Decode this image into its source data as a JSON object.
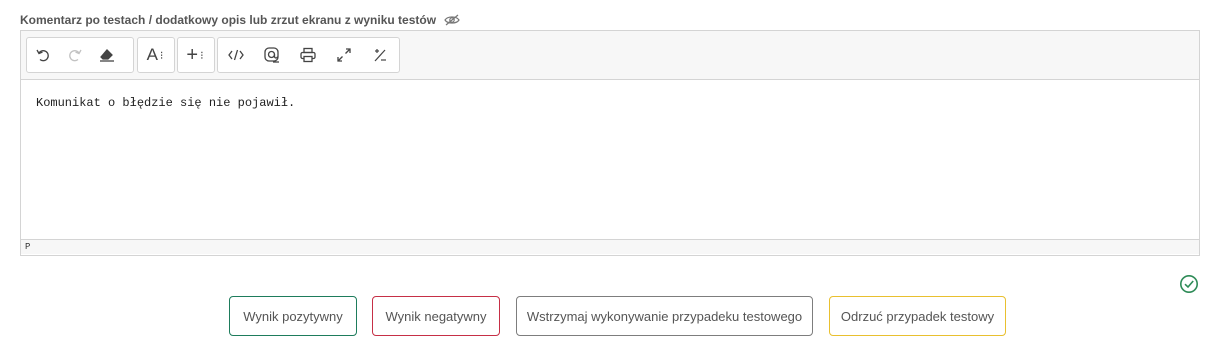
{
  "field": {
    "label": "Komentarz po testach / dodatkowy opis lub zrzut ekranu z wyniku testów",
    "visibility_icon": "eye-off-icon"
  },
  "toolbar": {
    "groups": [
      [
        "undo-icon",
        "redo-icon",
        "eraser-icon"
      ],
      [
        "font-icon"
      ],
      [
        "insert-icon"
      ],
      [
        "code-icon",
        "mention-icon",
        "print-icon",
        "fullscreen-icon",
        "superscript-subscript-icon"
      ]
    ],
    "font_glyph": "A",
    "insert_glyph": "+"
  },
  "editor": {
    "content": "Komunikat o błędzie się nie pojawił.",
    "status_path": "P"
  },
  "status": {
    "icon": "check-circle-icon",
    "color": "#2e8b57"
  },
  "actions": {
    "positive": {
      "label": "Wynik pozytywny",
      "color": "#1e7c5c"
    },
    "negative": {
      "label": "Wynik negatywny",
      "color": "#c62f46"
    },
    "suspend": {
      "label": "Wstrzymaj wykonywanie przypadeku testowego",
      "color": "#7d7d7d"
    },
    "reject": {
      "label": "Odrzuć przypadek testowy",
      "color": "#e9c02f"
    }
  }
}
